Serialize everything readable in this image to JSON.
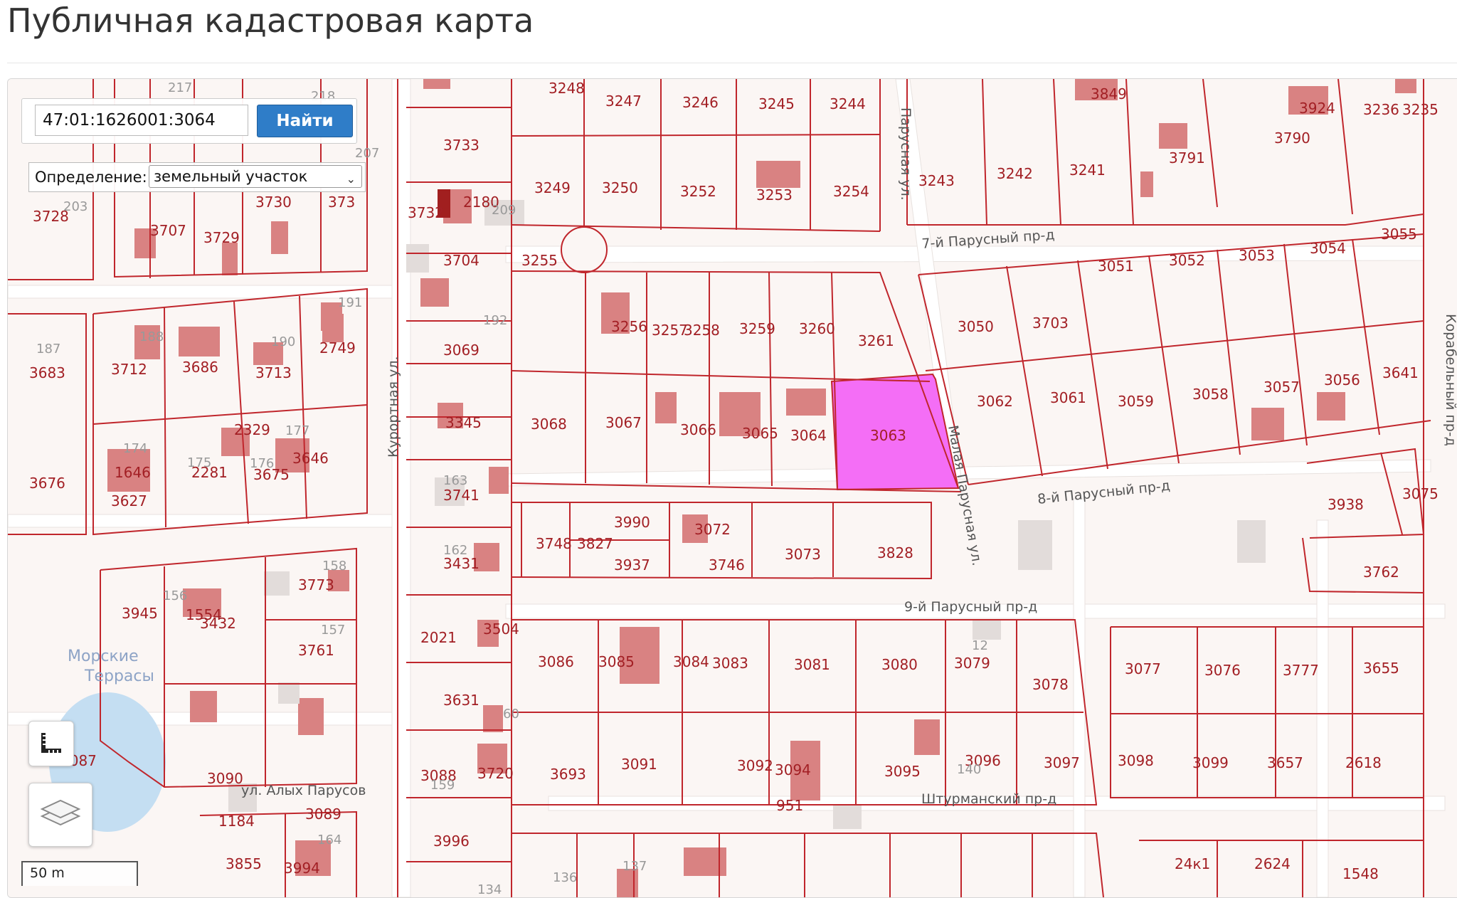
{
  "page": {
    "title": "Публичная кадастровая карта"
  },
  "search": {
    "value": "47:01:1626001:3064",
    "button_label": "Найти"
  },
  "definition": {
    "label": "Определение:",
    "selected": "земельный участок"
  },
  "scale": {
    "label": "50 m"
  },
  "colors": {
    "parcel_border": "#c0262c",
    "highlight_fill": "#f46ef6",
    "building_fill": "#d98282",
    "water_fill": "#c4def2"
  },
  "streets": [
    "7-й Парусный пр-д",
    "8-й Парусный пр-д",
    "9-й Парусный пр-д",
    "Штурманский пр-д",
    "Малая Парусная ул.",
    "Курортная ул.",
    "ул. Алых Парусов",
    "Корабельный пр-д",
    "Парусная ул.",
    "Морские",
    "Террасы"
  ],
  "parcels": [
    "3248",
    "3247",
    "3246",
    "3245",
    "3244",
    "3849",
    "3924",
    "3236",
    "3235",
    "3733",
    "3732",
    "3729",
    "3728",
    "3707",
    "2180",
    "3730",
    "373",
    "3249",
    "3250",
    "3252",
    "3253",
    "3254",
    "3243",
    "3242",
    "3241",
    "3791",
    "3790",
    "3704",
    "3255",
    "3055",
    "3054",
    "3053",
    "3052",
    "3051",
    "3712",
    "3686",
    "3713",
    "2749",
    "3683",
    "3256",
    "3257",
    "3258",
    "3259",
    "3260",
    "3261",
    "3050",
    "3703",
    "3069",
    "3068",
    "3067",
    "3066",
    "3065",
    "3064",
    "3063",
    "3062",
    "3061",
    "3059",
    "3058",
    "3057",
    "3056",
    "3641",
    "3345",
    "2329",
    "3646",
    "1646",
    "2281",
    "3675",
    "3676",
    "3627",
    "3741",
    "3748",
    "3827",
    "3990",
    "3072",
    "3746",
    "3073",
    "3828",
    "3937",
    "3938",
    "3075",
    "3762",
    "3431",
    "3773",
    "3945",
    "1554",
    "3432",
    "3761",
    "2021",
    "3504",
    "3087",
    "3086",
    "3085",
    "3084",
    "3083",
    "3081",
    "3080",
    "3079",
    "3078",
    "3077",
    "3076",
    "3777",
    "3655",
    "3631",
    "1184",
    "3089",
    "3090",
    "3091",
    "3092",
    "3094",
    "3095",
    "3096",
    "3097",
    "3098",
    "3099",
    "3657",
    "2618",
    "3088",
    "3720",
    "3693",
    "3855",
    "3994",
    "3996",
    "24к1",
    "2624",
    "1548",
    "951"
  ],
  "grey_numbers": [
    "209",
    "207",
    "218",
    "217",
    "203",
    "191",
    "192",
    "188",
    "190",
    "187",
    "174",
    "175",
    "176",
    "177",
    "163",
    "162",
    "158",
    "156",
    "157",
    "12",
    "140",
    "159",
    "136",
    "137",
    "60",
    "134",
    "164"
  ]
}
